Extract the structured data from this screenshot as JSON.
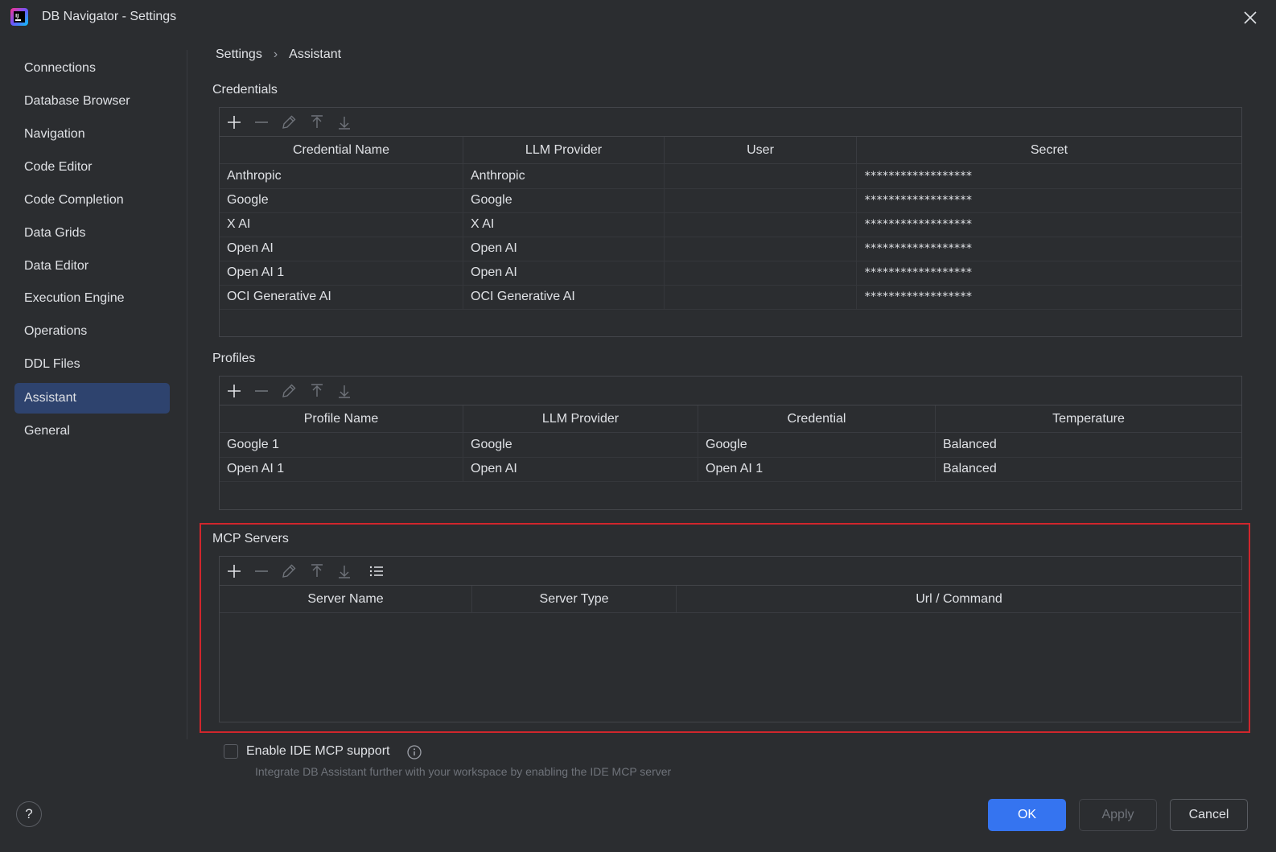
{
  "window": {
    "title": "DB Navigator - Settings"
  },
  "sidebar": {
    "items": [
      {
        "label": "Connections"
      },
      {
        "label": "Database Browser"
      },
      {
        "label": "Navigation"
      },
      {
        "label": "Code Editor"
      },
      {
        "label": "Code Completion"
      },
      {
        "label": "Data Grids"
      },
      {
        "label": "Data Editor"
      },
      {
        "label": "Execution Engine"
      },
      {
        "label": "Operations"
      },
      {
        "label": "DDL Files"
      },
      {
        "label": "Assistant",
        "active": true
      },
      {
        "label": "General"
      }
    ]
  },
  "breadcrumb": {
    "root": "Settings",
    "separator": "›",
    "current": "Assistant"
  },
  "credentials": {
    "title": "Credentials",
    "columns": [
      "Credential Name",
      "LLM Provider",
      "User",
      "Secret"
    ],
    "rows": [
      [
        "Anthropic",
        "Anthropic",
        "",
        "******************"
      ],
      [
        "Google",
        "Google",
        "",
        "******************"
      ],
      [
        "X AI",
        "X AI",
        "",
        "******************"
      ],
      [
        "Open AI",
        "Open AI",
        "",
        "******************"
      ],
      [
        "Open AI 1",
        "Open AI",
        "",
        "******************"
      ],
      [
        "OCI Generative AI",
        "OCI Generative AI",
        "",
        "******************"
      ]
    ]
  },
  "profiles": {
    "title": "Profiles",
    "columns": [
      "Profile Name",
      "LLM Provider",
      "Credential",
      "Temperature"
    ],
    "rows": [
      [
        "Google 1",
        "Google",
        "Google",
        "Balanced"
      ],
      [
        "Open AI 1",
        "Open AI",
        "Open AI 1",
        "Balanced"
      ]
    ]
  },
  "mcp": {
    "title": "MCP Servers",
    "columns": [
      "Server Name",
      "Server Type",
      "Url / Command"
    ],
    "rows": []
  },
  "toolbar_icons": [
    "plus-icon",
    "minus-icon",
    "edit-icon",
    "move-up-icon",
    "move-down-icon",
    "list-icon"
  ],
  "ide_mcp": {
    "label": "Enable IDE MCP support",
    "description": "Integrate DB Assistant further with your workspace by enabling the IDE MCP server",
    "checked": false
  },
  "footer": {
    "help": "?",
    "ok": "OK",
    "apply": "Apply",
    "cancel": "Cancel"
  },
  "colors": {
    "accent": "#3574f0",
    "background": "#2b2d30",
    "selection": "#2e436e",
    "highlight": "#d0262c"
  }
}
